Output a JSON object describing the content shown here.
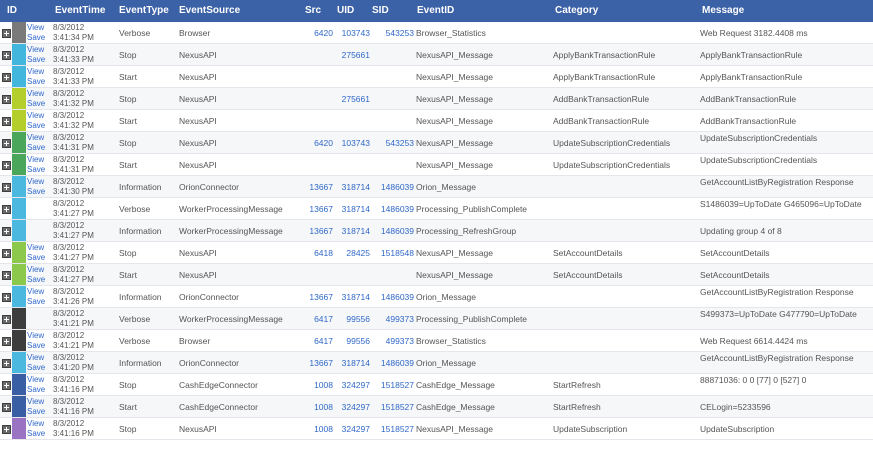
{
  "grid": {
    "columns": {
      "id": "ID",
      "event_time": "EventTime",
      "event_type": "EventType",
      "event_source": "EventSource",
      "src": "Src",
      "uid": "UID",
      "sid": "SID",
      "event_id": "EventID",
      "category": "Category",
      "message": "Message"
    },
    "colors": {
      "header": "#3b61a6",
      "link": "#2f68c9",
      "alt_row": "#f6f7f9"
    },
    "rows": [
      {
        "swatch": "#7a7a7a",
        "view": "View",
        "save": "Save",
        "date": "8/3/2012",
        "time": "3:41:34 PM",
        "type": "Verbose",
        "source": "Browser",
        "src": "6420",
        "uid": "103743",
        "sid": "543253",
        "event_id": "Browser_Statistics",
        "category": "",
        "message": "Web Request 3182.4408 ms"
      },
      {
        "swatch": "#42b6dd",
        "view": "View",
        "save": "Save",
        "date": "8/3/2012",
        "time": "3:41:33 PM",
        "type": "Stop",
        "source": "NexusAPI",
        "src": "",
        "uid": "275661",
        "sid": "",
        "event_id": "NexusAPI_Message",
        "category": "ApplyBankTransactionRule",
        "message": "ApplyBankTransactionRule"
      },
      {
        "swatch": "#42b6dd",
        "view": "View",
        "save": "Save",
        "date": "8/3/2012",
        "time": "3:41:33 PM",
        "type": "Start",
        "source": "NexusAPI",
        "src": "",
        "uid": "",
        "sid": "",
        "event_id": "NexusAPI_Message",
        "category": "ApplyBankTransactionRule",
        "message": "ApplyBankTransactionRule"
      },
      {
        "swatch": "#b4cf2b",
        "view": "View",
        "save": "Save",
        "date": "8/3/2012",
        "time": "3:41:32 PM",
        "type": "Stop",
        "source": "NexusAPI",
        "src": "",
        "uid": "275661",
        "sid": "",
        "event_id": "NexusAPI_Message",
        "category": "AddBankTransactionRule",
        "message": "AddBankTransactionRule"
      },
      {
        "swatch": "#b4cf2b",
        "view": "View",
        "save": "Save",
        "date": "8/3/2012",
        "time": "3:41:32 PM",
        "type": "Start",
        "source": "NexusAPI",
        "src": "",
        "uid": "",
        "sid": "",
        "event_id": "NexusAPI_Message",
        "category": "AddBankTransactionRule",
        "message": "AddBankTransactionRule"
      },
      {
        "swatch": "#4aa65a",
        "view": "View",
        "save": "Save",
        "date": "8/3/2012",
        "time": "3:41:31 PM",
        "type": "Stop",
        "source": "NexusAPI",
        "src": "6420",
        "uid": "103743",
        "sid": "543253",
        "event_id": "NexusAPI_Message",
        "category": "UpdateSubscriptionCredentials",
        "message": "UpdateSubscriptionCredentials"
      },
      {
        "swatch": "#4aa65a",
        "view": "View",
        "save": "Save",
        "date": "8/3/2012",
        "time": "3:41:31 PM",
        "type": "Start",
        "source": "NexusAPI",
        "src": "",
        "uid": "",
        "sid": "",
        "event_id": "NexusAPI_Message",
        "category": "UpdateSubscriptionCredentials",
        "message": "UpdateSubscriptionCredentials"
      },
      {
        "swatch": "#4bb9df",
        "view": "View",
        "save": "Save",
        "date": "8/3/2012",
        "time": "3:41:30 PM",
        "type": "Information",
        "source": "OrionConnector",
        "src": "13667",
        "uid": "318714",
        "sid": "1486039",
        "event_id": "Orion_Message",
        "category": "",
        "message": "GetAccountListByRegistration Response"
      },
      {
        "swatch": "#4bb9df",
        "view": "",
        "save": "",
        "date": "8/3/2012",
        "time": "3:41:27 PM",
        "type": "Verbose",
        "source": "WorkerProcessingMessage",
        "src": "13667",
        "uid": "318714",
        "sid": "1486039",
        "event_id": "Processing_PublishComplete",
        "category": "",
        "message": "S1486039=UpToDate G465096=UpToDate"
      },
      {
        "swatch": "#4bb9df",
        "view": "",
        "save": "",
        "date": "8/3/2012",
        "time": "3:41:27 PM",
        "type": "Information",
        "source": "WorkerProcessingMessage",
        "src": "13667",
        "uid": "318714",
        "sid": "1486039",
        "event_id": "Processing_RefreshGroup",
        "category": "",
        "message": "Updating group 4 of 8"
      },
      {
        "swatch": "#8cc84b",
        "view": "View",
        "save": "Save",
        "date": "8/3/2012",
        "time": "3:41:27 PM",
        "type": "Stop",
        "source": "NexusAPI",
        "src": "6418",
        "uid": "28425",
        "sid": "1518548",
        "event_id": "NexusAPI_Message",
        "category": "SetAccountDetails",
        "message": "SetAccountDetails"
      },
      {
        "swatch": "#8cc84b",
        "view": "View",
        "save": "Save",
        "date": "8/3/2012",
        "time": "3:41:27 PM",
        "type": "Start",
        "source": "NexusAPI",
        "src": "",
        "uid": "",
        "sid": "",
        "event_id": "NexusAPI_Message",
        "category": "SetAccountDetails",
        "message": "SetAccountDetails"
      },
      {
        "swatch": "#4bb9df",
        "view": "View",
        "save": "Save",
        "date": "8/3/2012",
        "time": "3:41:26 PM",
        "type": "Information",
        "source": "OrionConnector",
        "src": "13667",
        "uid": "318714",
        "sid": "1486039",
        "event_id": "Orion_Message",
        "category": "",
        "message": "GetAccountListByRegistration Response"
      },
      {
        "swatch": "#3d3d3d",
        "view": "",
        "save": "",
        "date": "8/3/2012",
        "time": "3:41:21 PM",
        "type": "Verbose",
        "source": "WorkerProcessingMessage",
        "src": "6417",
        "uid": "99556",
        "sid": "499373",
        "event_id": "Processing_PublishComplete",
        "category": "",
        "message": "S499373=UpToDate G477790=UpToDate"
      },
      {
        "swatch": "#3d3d3d",
        "view": "View",
        "save": "Save",
        "date": "8/3/2012",
        "time": "3:41:21 PM",
        "type": "Verbose",
        "source": "Browser",
        "src": "6417",
        "uid": "99556",
        "sid": "499373",
        "event_id": "Browser_Statistics",
        "category": "",
        "message": "Web Request 6614.4424 ms"
      },
      {
        "swatch": "#4bb9df",
        "view": "View",
        "save": "Save",
        "date": "8/3/2012",
        "time": "3:41:20 PM",
        "type": "Information",
        "source": "OrionConnector",
        "src": "13667",
        "uid": "318714",
        "sid": "1486039",
        "event_id": "Orion_Message",
        "category": "",
        "message": "GetAccountListByRegistration Response"
      },
      {
        "swatch": "#3a5ea3",
        "view": "View",
        "save": "Save",
        "date": "8/3/2012",
        "time": "3:41:16 PM",
        "type": "Stop",
        "source": "CashEdgeConnector",
        "src": "1008",
        "uid": "324297",
        "sid": "1518527",
        "event_id": "CashEdge_Message",
        "category": "StartRefresh",
        "message": "88871036: 0 0 [77] 0 [527] 0"
      },
      {
        "swatch": "#3a5ea3",
        "view": "View",
        "save": "Save",
        "date": "8/3/2012",
        "time": "3:41:16 PM",
        "type": "Start",
        "source": "CashEdgeConnector",
        "src": "1008",
        "uid": "324297",
        "sid": "1518527",
        "event_id": "CashEdge_Message",
        "category": "StartRefresh",
        "message": "CELogin=5233596"
      },
      {
        "swatch": "#9a73c2",
        "view": "View",
        "save": "Save",
        "date": "8/3/2012",
        "time": "3:41:16 PM",
        "type": "Stop",
        "source": "NexusAPI",
        "src": "1008",
        "uid": "324297",
        "sid": "1518527",
        "event_id": "NexusAPI_Message",
        "category": "UpdateSubscription",
        "message": "UpdateSubscription"
      }
    ]
  }
}
